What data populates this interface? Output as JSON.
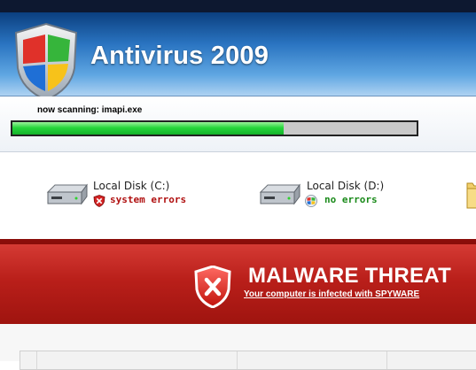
{
  "app": {
    "title": "Antivirus 2009"
  },
  "scan": {
    "label": "now scanning: imapi.exe",
    "progress": 0.67
  },
  "disks": [
    {
      "name": "Local Disk (C:)",
      "status": "system errors",
      "status_color": "#b01010"
    },
    {
      "name": "Local Disk (D:)",
      "status": "no errors",
      "status_color": "#1a8a1a"
    }
  ],
  "threat": {
    "title": "MALWARE THREAT",
    "message": "Your computer is infected with SPYWARE"
  },
  "colors": {
    "header_blue": "#2a74c1",
    "progress_green": "#26d63b",
    "threat_red": "#b91f1a"
  },
  "icons": {
    "app_logo": "windows-shield-icon",
    "disk": "hard-disk-icon",
    "error": "red-x-icon",
    "ok": "windows-logo-icon",
    "folder": "folder-icon",
    "threat": "red-shield-x-icon"
  }
}
